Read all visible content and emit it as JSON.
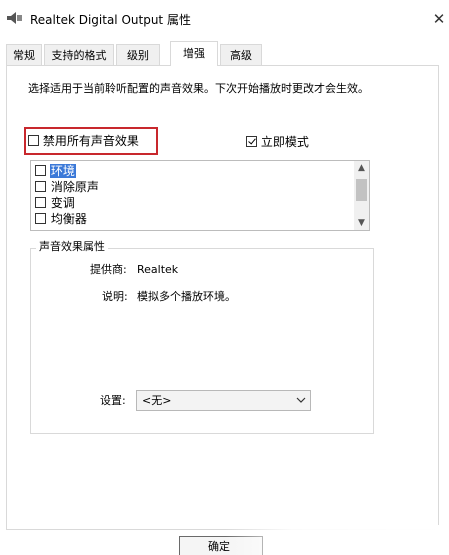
{
  "window": {
    "title": "Realtek Digital Output 属性",
    "close_glyph": "✕"
  },
  "tabs": [
    {
      "label": "常规",
      "active": false
    },
    {
      "label": "支持的格式",
      "active": false
    },
    {
      "label": "级别",
      "active": false
    },
    {
      "label": "增强",
      "active": true
    },
    {
      "label": "高级",
      "active": false
    }
  ],
  "enhancements": {
    "description": "选择适用于当前聆听配置的声音效果。下次开始播放时更改才会生效。",
    "disable_all_label": "禁用所有声音效果",
    "disable_all_checked": false,
    "immediate_mode_label": "立即模式",
    "immediate_mode_checked": true,
    "effects": [
      {
        "label": "环境",
        "checked": false,
        "selected": true
      },
      {
        "label": "消除原声",
        "checked": false,
        "selected": false
      },
      {
        "label": "变调",
        "checked": false,
        "selected": false
      },
      {
        "label": "均衡器",
        "checked": false,
        "selected": false
      }
    ],
    "properties": {
      "group_title": "声音效果属性",
      "provider_label": "提供商:",
      "provider_value": "Realtek",
      "description_label": "说明:",
      "description_value": "模拟多个播放环境。",
      "settings_label": "设置:",
      "settings_value": "<无>"
    }
  },
  "footer": {
    "ok_label": "确定"
  },
  "colors": {
    "highlight_box": "#c8282d",
    "selection": "#3b79d8"
  }
}
